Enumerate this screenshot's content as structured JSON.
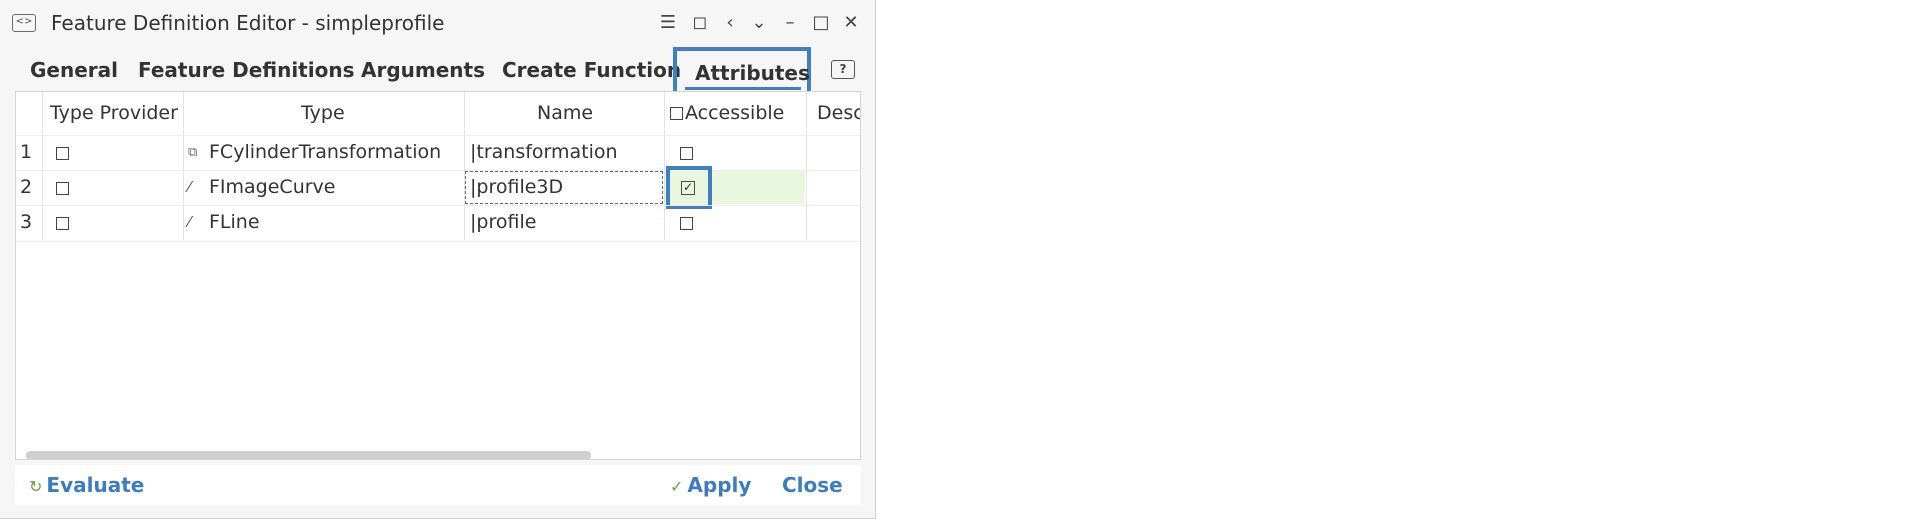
{
  "window": {
    "title": "Feature Definition Editor - simpleprofile"
  },
  "tabs": [
    {
      "label": "General"
    },
    {
      "label": "Feature Definitions"
    },
    {
      "label": "Arguments"
    },
    {
      "label": "Create Function"
    },
    {
      "label": "Attributes",
      "active": true
    }
  ],
  "table": {
    "columns": [
      "Type Provider",
      "Type",
      "Name",
      "Accessible",
      "Desc"
    ],
    "rows": [
      {
        "num": "1",
        "type_provider_checked": false,
        "type": "FCylinderTransformation",
        "type_icon": "transformation-icon",
        "name": "|transformation",
        "accessible_checked": false
      },
      {
        "num": "2",
        "type_provider_checked": false,
        "type": "FImageCurve",
        "type_icon": "curve-icon",
        "name": "|profile3D",
        "accessible_checked": true
      },
      {
        "num": "3",
        "type_provider_checked": false,
        "type": "FLine",
        "type_icon": "line-icon",
        "name": "|profile",
        "accessible_checked": false
      }
    ]
  },
  "footer": {
    "evaluate": "Evaluate",
    "apply": "Apply",
    "close": "Close"
  },
  "colors": {
    "accent": "#3f7fc6",
    "highlight_cell": "#e9f7df",
    "icon_green": "#5aa83a"
  }
}
